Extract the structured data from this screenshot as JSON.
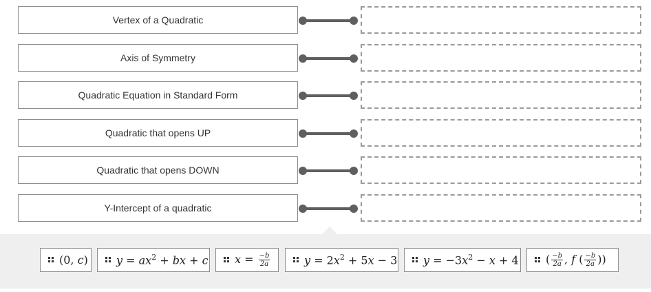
{
  "terms": [
    "Vertex of a Quadratic",
    "Axis of Symmetry",
    "Quadratic Equation in Standard Form",
    "Quadratic that opens UP",
    "Quadratic that opens DOWN",
    "Y-Intercept of a quadratic"
  ],
  "tiles": {
    "t1": {
      "open": "(0, ",
      "var": "c",
      "close": ")"
    },
    "t2": {
      "y": "y",
      "eq": " = ",
      "a": "a",
      "x": "x",
      "sq": "2",
      "plus1": " + ",
      "b": "b",
      "x2": "x",
      "plus2": " + ",
      "c": "c"
    },
    "t3": {
      "x": "x",
      "eq": " = ",
      "num": "−b",
      "den": "2a"
    },
    "t4": {
      "y": "y",
      "eq": " = 2",
      "x": "x",
      "sq": "2",
      "mid": " + 5",
      "x2": "x",
      "tail": " − 3"
    },
    "t5": {
      "y": "y",
      "eq": " = −3",
      "x": "x",
      "sq": "2",
      "mid": " − ",
      "x2": "x",
      "tail": " + 4"
    },
    "t6": {
      "open": "(",
      "num1": "−b",
      "den1": "2a",
      "comma": ", ",
      "f": "f",
      "open2": " (",
      "num2": "−b",
      "den2": "2a",
      "close": "))"
    }
  }
}
